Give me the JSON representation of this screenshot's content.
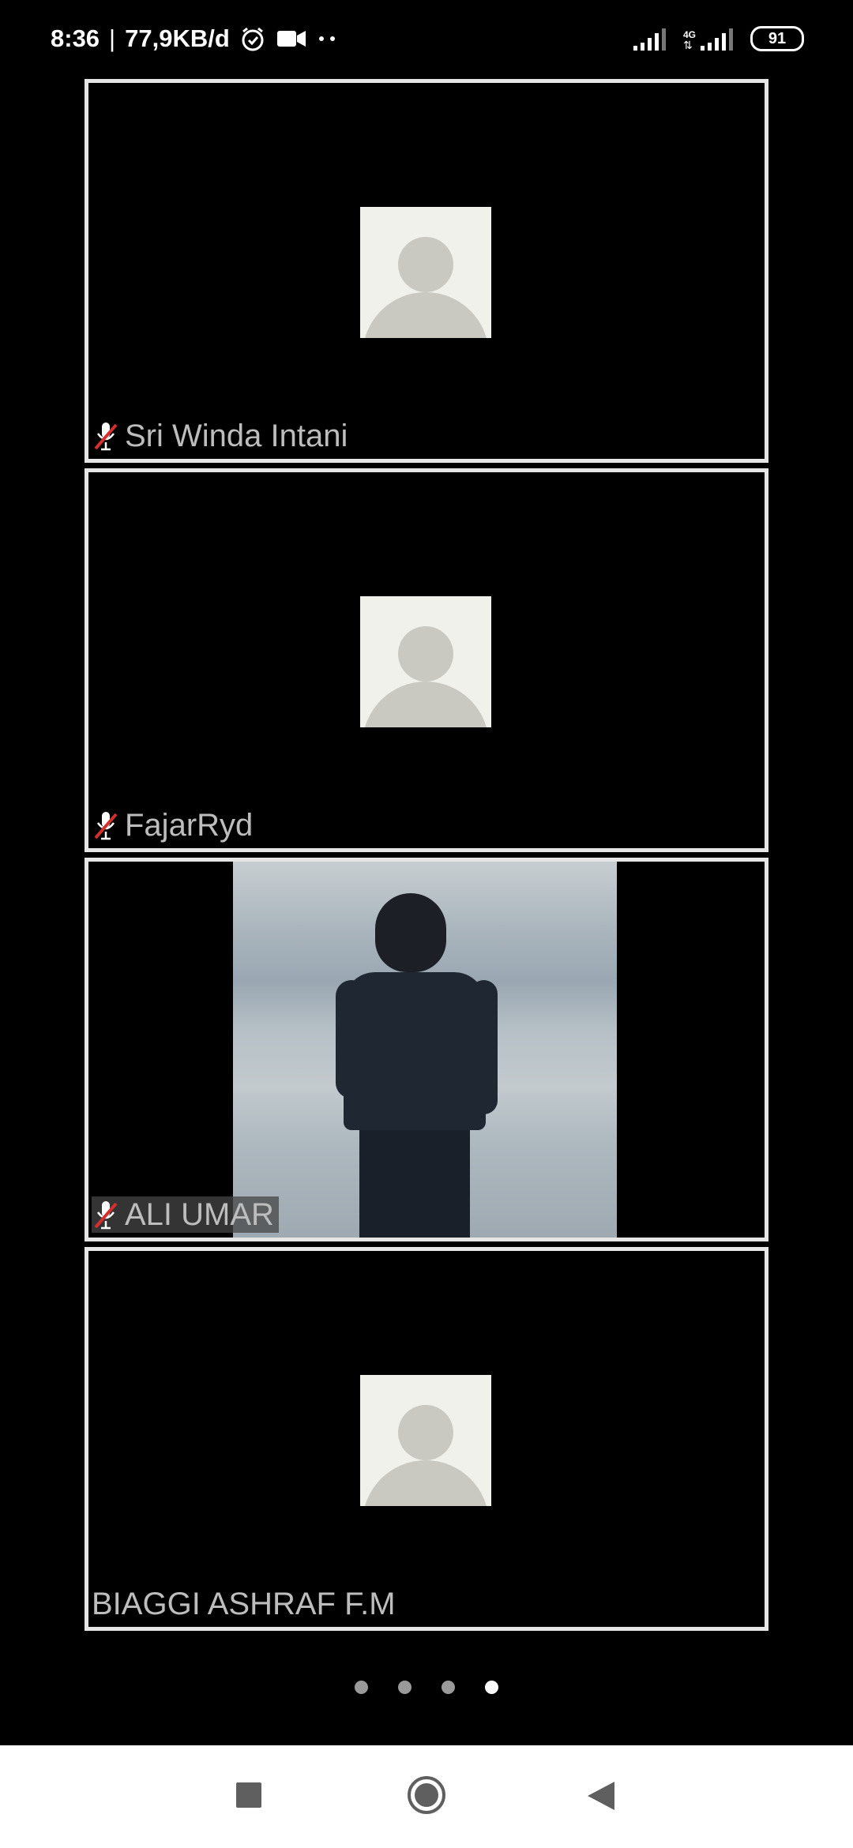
{
  "status_bar": {
    "time": "8:36",
    "separator": "|",
    "data_speed": "77,9KB/d",
    "network_type": "4G",
    "battery": "91",
    "icons": [
      "alarm-icon",
      "video-camera-icon",
      "more-dots-icon",
      "signal-icon",
      "signal-4g-icon",
      "battery-icon"
    ]
  },
  "participants": [
    {
      "name": "Sri Winda Intani",
      "muted": true,
      "video": false
    },
    {
      "name": "FajarRyd",
      "muted": true,
      "video": false
    },
    {
      "name": "ALI UMAR",
      "muted": true,
      "video": true
    },
    {
      "name": "BIAGGI ASHRAF F.M",
      "muted": false,
      "video": false
    }
  ],
  "pager": {
    "pages": 4,
    "current": 4
  },
  "nav": {
    "buttons": [
      "recents-button",
      "home-button",
      "back-button"
    ]
  },
  "colors": {
    "background": "#000000",
    "tile_border": "#e6e6e6",
    "name_text": "#bdbdbd",
    "avatar_bg": "#f1f1ec",
    "avatar_fg": "#c9c9c2",
    "mute_slash": "#d32f2f",
    "dot_active": "#ffffff",
    "dot_inactive": "#9a9a9a"
  }
}
